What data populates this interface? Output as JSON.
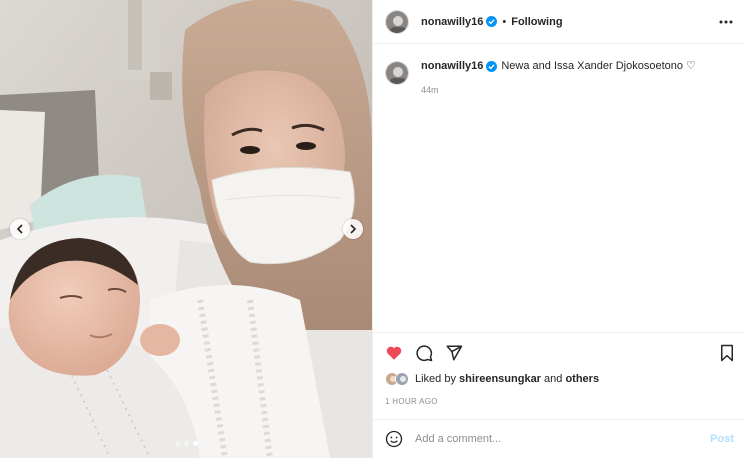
{
  "header": {
    "username": "nonawilly16",
    "separator": "•",
    "follow_status": "Following"
  },
  "caption": {
    "username": "nonawilly16",
    "text": "Newa and Issa Xander Djokosoetono ♡",
    "time_ago": "44m"
  },
  "likes": {
    "prefix": "Liked by",
    "user": "shireensungkar",
    "middle": "and",
    "others": "others"
  },
  "timestamp": "1 HOUR AGO",
  "comment": {
    "placeholder": "Add a comment...",
    "post_label": "Post"
  },
  "carousel": {
    "slide_count": 3,
    "active_index": 2
  },
  "colors": {
    "like": "#ed4956",
    "verified": "#0095f6",
    "post_disabled": "#b2dffc",
    "secondary_text": "#8e8e8e"
  },
  "icons": [
    "chevron-left-icon",
    "chevron-right-icon",
    "verified-badge-icon",
    "more-options-icon",
    "heart-icon",
    "comment-icon",
    "share-icon",
    "bookmark-icon",
    "emoji-icon"
  ]
}
